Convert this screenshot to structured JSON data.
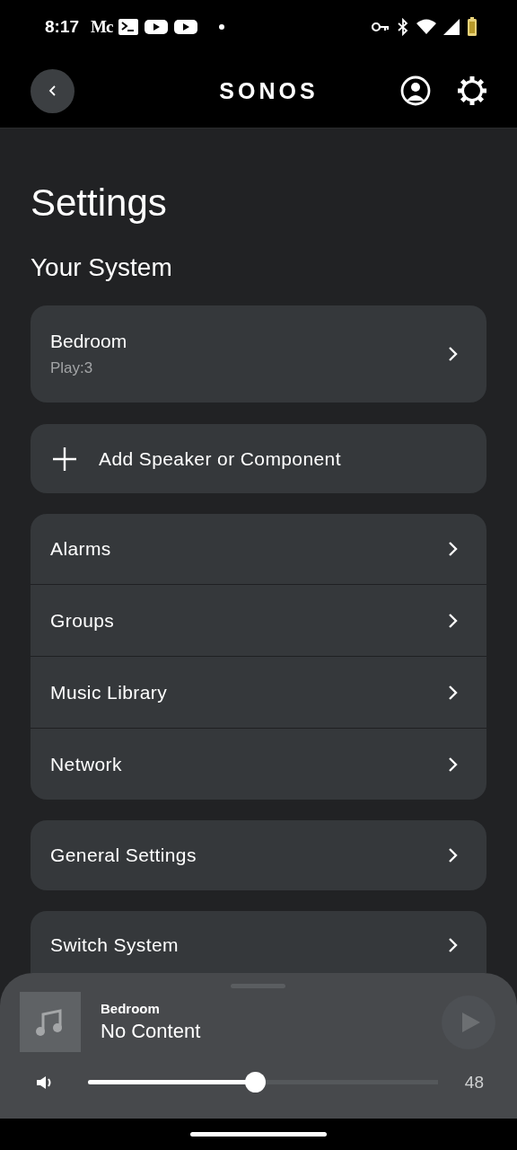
{
  "status_bar": {
    "time": "8:17",
    "notification_text": "Mc"
  },
  "header": {
    "title": "SONOS"
  },
  "page": {
    "title": "Settings",
    "section": "Your System"
  },
  "system_card": {
    "name": "Bedroom",
    "model": "Play:3"
  },
  "add_button": {
    "label": "Add Speaker or Component"
  },
  "menu_groups": [
    {
      "items": [
        {
          "label": "Alarms"
        },
        {
          "label": "Groups"
        },
        {
          "label": "Music Library"
        },
        {
          "label": "Network"
        }
      ]
    },
    {
      "items": [
        {
          "label": "General Settings"
        }
      ]
    },
    {
      "items": [
        {
          "label": "Switch System"
        }
      ]
    }
  ],
  "player": {
    "room": "Bedroom",
    "title": "No Content",
    "volume": {
      "level": 0.48,
      "reading": "48"
    }
  }
}
